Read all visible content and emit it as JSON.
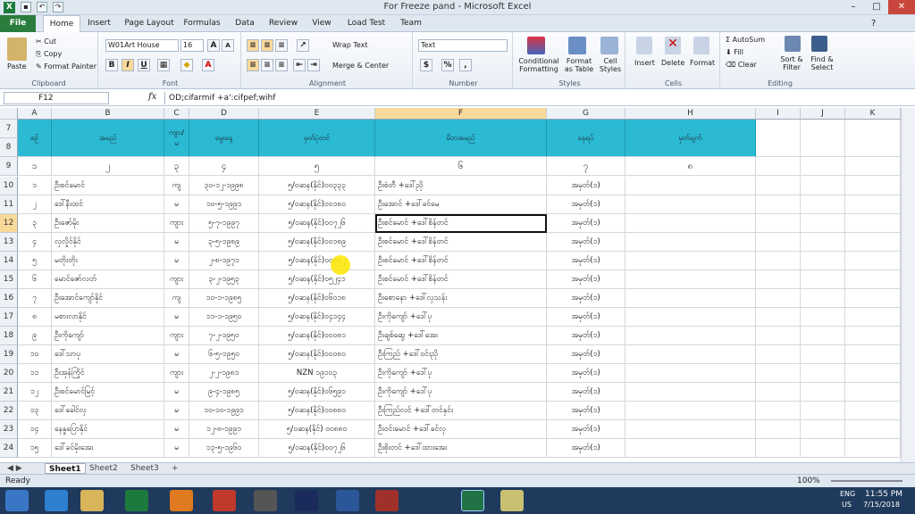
{
  "window": {
    "title": "For Freeze pand - Microsoft Excel"
  },
  "tabs": [
    "File",
    "Home",
    "Insert",
    "Page Layout",
    "Formulas",
    "Data",
    "Review",
    "View",
    "Load Test",
    "Team"
  ],
  "ribbon": {
    "clipboard": {
      "paste": "Paste",
      "cut": "Cut",
      "copy": "Copy",
      "format_painter": "Format Painter",
      "label": "Clipboard"
    },
    "font": {
      "name": "W01Art House",
      "size": "16",
      "label": "Font",
      "bold": "B",
      "italic": "I",
      "underline": "U"
    },
    "alignment": {
      "wrap": "Wrap Text",
      "merge": "Merge & Center",
      "label": "Alignment"
    },
    "number": {
      "format": "Text",
      "currency": "$",
      "percent": "%",
      "comma": ",",
      "label": "Number"
    },
    "styles": {
      "cond": "Conditional Formatting",
      "table": "Format as Table",
      "cell": "Cell Styles",
      "label": "Styles"
    },
    "cells": {
      "insert": "Insert",
      "delete": "Delete",
      "format": "Format",
      "label": "Cells"
    },
    "editing": {
      "autosum": "AutoSum",
      "fill": "Fill",
      "clear": "Clear",
      "sort": "Sort & Filter",
      "find": "Find & Select",
      "label": "Editing"
    }
  },
  "formula_bar": {
    "name_box": "F12",
    "fx": "fx",
    "value": "OD;cifarmif +a':cifpef;wihf"
  },
  "columns": [
    "A",
    "B",
    "C",
    "D",
    "E",
    "F",
    "G",
    "H",
    "I",
    "J",
    "K"
  ],
  "header_rows": [
    "7",
    "8"
  ],
  "headers": [
    "စဉ်",
    "အမည်",
    "ကျား/မ",
    "မွေးနေ့",
    "မှတ်ပုံတင်",
    "မိဘအမည်",
    "နေရပ်",
    "မှတ်ချက်"
  ],
  "number_row": {
    "row": "9",
    "values": [
      "၁",
      "၂",
      "၃",
      "၄",
      "၅",
      "၆",
      "၇",
      "၈"
    ]
  },
  "rows": [
    {
      "row": "10",
      "cells": [
        "၁",
        "ဦးစင်မောင်",
        "ကျ",
        "၃၀-၁၂-၁၉၉၈",
        "၅/ဝဆန(နိုင်)၀၀၃၃၃",
        "ဦးစံတီ +ဒေါ်ညို",
        "အမှတ်(၁)",
        ""
      ]
    },
    {
      "row": "11",
      "cells": [
        "၂",
        "ဒေါ်နီးထင်",
        "မ",
        "၁၀-၅-၁၉၉၁",
        "၅/ဝဆန(နိုင်)၀၀၁၈၀",
        "ဦးအောင် +ဒေါ်ခင်မေ",
        "အမှတ်(၁)",
        ""
      ]
    },
    {
      "row": "12",
      "cells": [
        "၃",
        "ဦးဇော်မိုး",
        "ကျား",
        "၅-၇-၁၉၉၇",
        "၅/ဝဆန(နိုင်)၀၀၇၂၆",
        "ဦးစင်မောင် +ဒေါ်စိန်တင်",
        "အမှတ်(၁)",
        ""
      ]
    },
    {
      "row": "13",
      "cells": [
        "၄",
        "လှလှိုင်နိုင်",
        "မ",
        "၃-၅-၁၉၈၉",
        "၅/ဝဆန(နိုင်)၀၀၁၈၉",
        "ဦးစင်မောင် +ဒေါ်စိန်တင်",
        "အမှတ်(၁)",
        ""
      ]
    },
    {
      "row": "14",
      "cells": [
        "၅",
        "မတိုးတိုး",
        "မ",
        "၂-၈-၁၉၇၁",
        "၅/ဝဆန(နိုင်)၀၀၁၇၂",
        "ဦးစင်မောင် +ဒေါ်စိန်တင်",
        "အမှတ်(၁)",
        ""
      ]
    },
    {
      "row": "15",
      "cells": [
        "၆",
        "မောင်ဇော်လတ်",
        "ကျား",
        "၃-၂-၁၉၅၃",
        "၅/ဝဆန(နိုင်)၀၅၂၄၁",
        "ဦးစင်မောင် +ဒေါ်စိန်တင်",
        "အမှတ်(၁)",
        ""
      ]
    },
    {
      "row": "16",
      "cells": [
        "၇",
        "ဦးအောင်ကျော်နိုင်",
        "ကျ",
        "၁၀-၁-၁၉၈၅",
        "၅/ဝဆန(နိုင်)၀၆၀၁၈",
        "ဦးစောနော +ဒေါ်လှသန်း",
        "အမှတ်(၁)",
        ""
      ]
    },
    {
      "row": "17",
      "cells": [
        "၈",
        "မစားလာနိုင်",
        "မ",
        "၁၁-၁-၁၉၅၀",
        "၅/ဝဆန(နိုင်)၀၄၁၄၄",
        "ဦးကိုကျော် +ဒေါ်ပု",
        "အမှတ်(၁)",
        ""
      ]
    },
    {
      "row": "18",
      "cells": [
        "၉",
        "ဦးကိုကျော်",
        "ကျား",
        "၇-၂-၁၉၅၀",
        "၅/ဝဆန(နိုင်)၀၀၀၈၁",
        "ဦးချစ်ဆွေ +ဒေါ်အေး",
        "အမှတ်(၁)",
        ""
      ]
    },
    {
      "row": "19",
      "cells": [
        "၁၀",
        "ဒေါ်သာပု",
        "မ",
        "၆-၅-၁၉၅၀",
        "၅/ဝဆန(နိုင်)၀၀၀၈၀",
        "ဦးကြည် +ဒေါ်ဝင်းညို",
        "အမှတ်(၁)",
        ""
      ]
    },
    {
      "row": "20",
      "cells": [
        "၁၁",
        "ဦးအုန်ကြိုင်",
        "ကျား",
        "၂-၂-၁၉၈၁",
        "NZN ၁၉၁၀၃",
        "ဦးကိုကျော် +ဒေါ်ပု",
        "အမှတ်(၁)",
        ""
      ]
    },
    {
      "row": "21",
      "cells": [
        "၁၂",
        "ဦးစင်မောင်မြင့်",
        "မ",
        "၉-၄-၁၉၈၅",
        "၅/ဝဆန(နိုင်)၀၆၅၉၁",
        "ဦးကိုကျော် +ဒေါ်ပု",
        "အမှတ်(၁)",
        ""
      ]
    },
    {
      "row": "22",
      "cells": [
        "၁၃",
        "ဒေါ်ခေါင်လှ",
        "မ",
        "၁၀-၁၀-၁၉၉၁",
        "၅/ဝဆန(နိုင်)၀၀၈၈၀",
        "ဦးကြည်လင် +ဒေါ်တင်နှင်း",
        "အမှတ်(၁)",
        ""
      ]
    },
    {
      "row": "23",
      "cells": [
        "၁၄",
        "နေနှုပြောနိုင်",
        "မ",
        "၁၂-၈-၁၉၉၁",
        "၅/ဝဆန(နိုင်) ၀၀၈၈၀",
        "ဦးဝင်းမောင် +ဒေါ်ခင်လှ",
        "အမှတ်(၁)",
        ""
      ]
    },
    {
      "row": "24",
      "cells": [
        "၁၅",
        "ဒေါ်ခင်မိုးအေး",
        "မ",
        "၁၃-၅-၁၉၆၀",
        "၅/ဝဆန(နိုင်)၀၀၇၂၆",
        "ဦးစိုးတင် +ဒေါ်ထားအေး",
        "အမှတ်(၁)",
        ""
      ]
    }
  ],
  "sheets": [
    "Sheet1",
    "Sheet2",
    "Sheet3"
  ],
  "status": {
    "ready": "Ready",
    "zoom": "100%"
  },
  "taskbar": {
    "lang": "ENG",
    "region": "US",
    "time": "11:55 PM",
    "date": "7/15/2018"
  },
  "colors": {
    "header_fill": "#2bb9d4",
    "selected_header": "#f9d99a",
    "file_tab": "#2a7d3d",
    "taskbar": "#1f3a5c"
  }
}
